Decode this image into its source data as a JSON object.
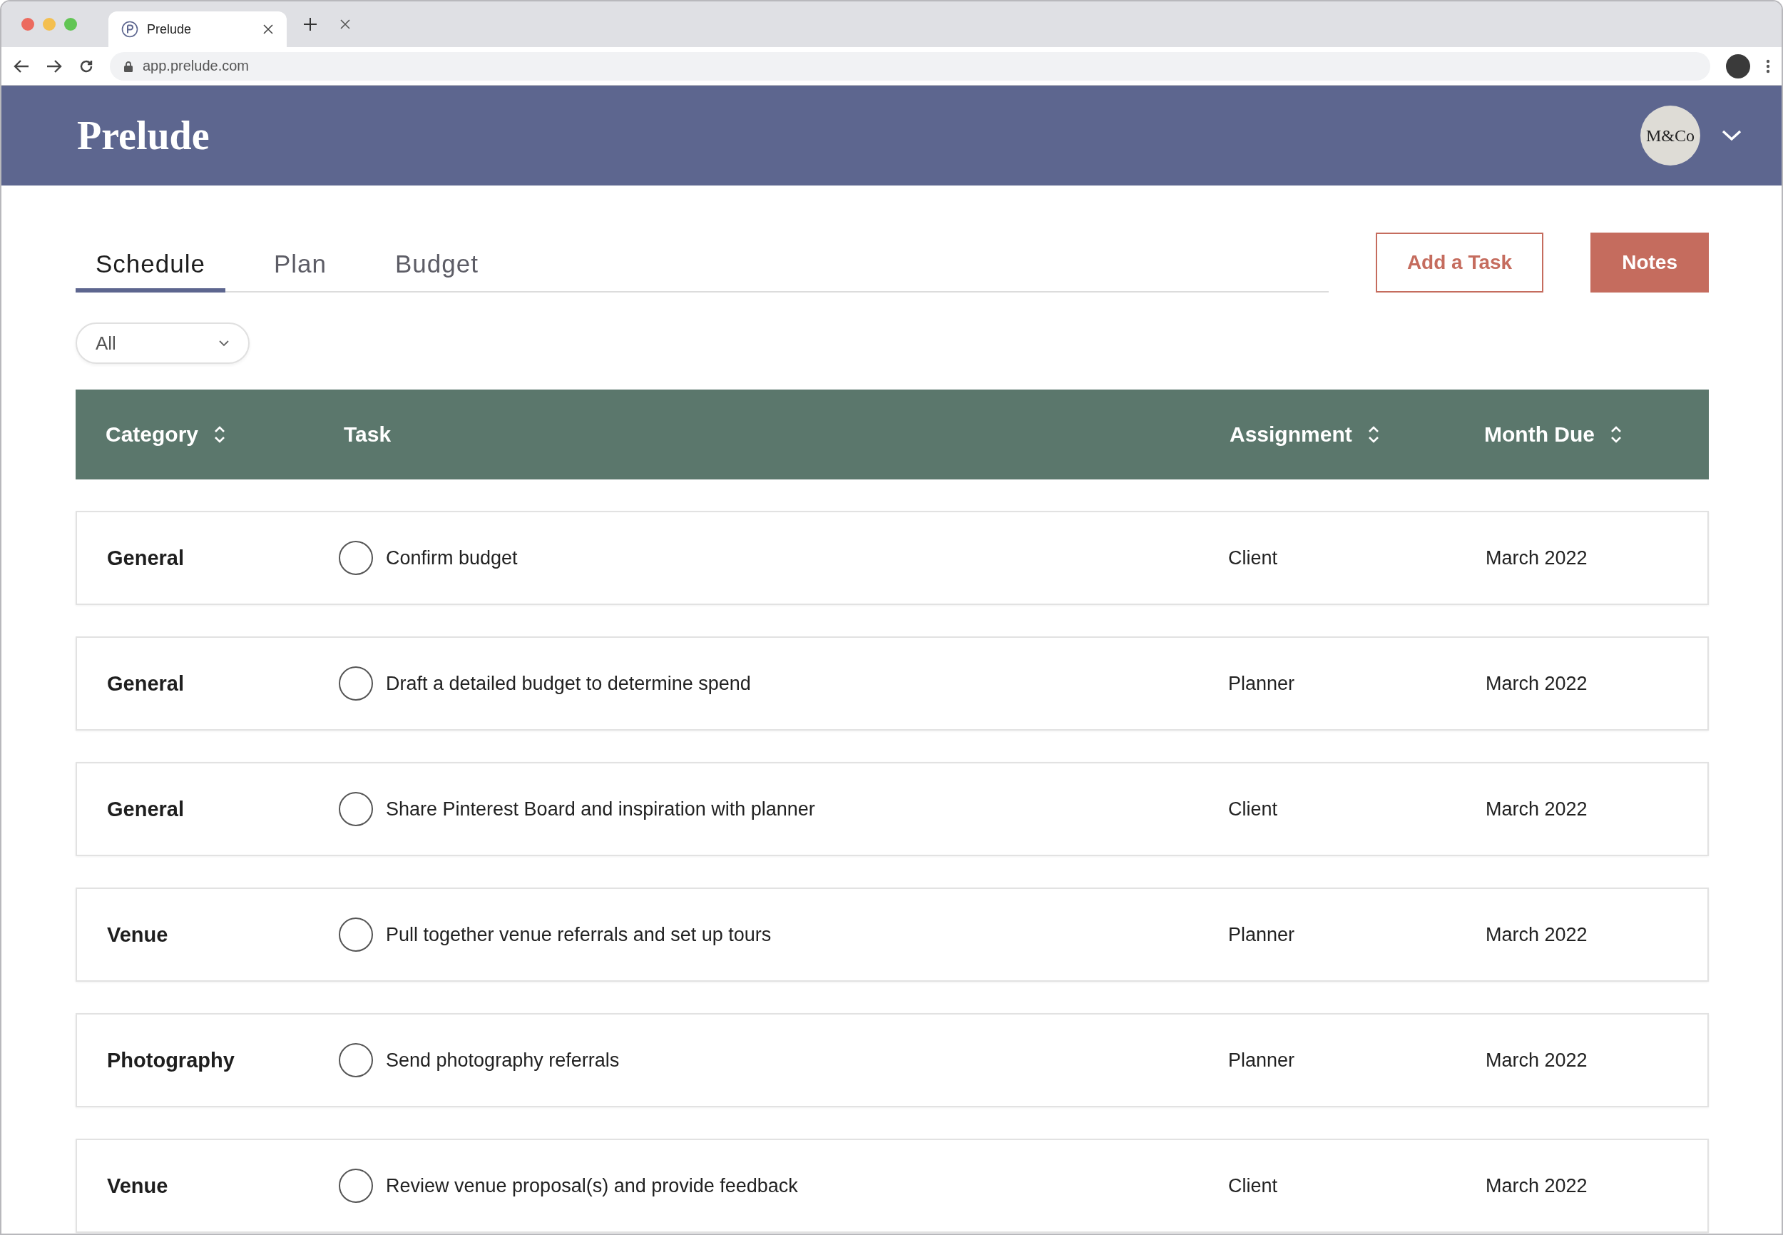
{
  "browser": {
    "tab_title": "Prelude",
    "url": "app.prelude.com"
  },
  "header": {
    "logo": "Prelude",
    "avatar_text": "M&Co"
  },
  "tabs": [
    {
      "label": "Schedule",
      "selected": true
    },
    {
      "label": "Plan",
      "selected": false
    },
    {
      "label": "Budget",
      "selected": false
    }
  ],
  "actions": [
    {
      "label": "Add a Task",
      "kind": "outline"
    },
    {
      "label": "Notes",
      "kind": "filled"
    }
  ],
  "filter": {
    "value": "All"
  },
  "table": {
    "columns": [
      {
        "label": "Category",
        "sortable": true
      },
      {
        "label": "Task",
        "sortable": false
      },
      {
        "label": "Assignment",
        "sortable": true
      },
      {
        "label": "Month Due",
        "sortable": true
      }
    ],
    "rows": [
      {
        "category": "General",
        "task": "Confirm budget",
        "checked": false,
        "assignment": "Client",
        "month": "March 2022"
      },
      {
        "category": "General",
        "task": "Draft a detailed budget to determine spend",
        "checked": false,
        "assignment": "Planner",
        "month": "March 2022"
      },
      {
        "category": "General",
        "task": "Share Pinterest Board and inspiration with planner",
        "checked": false,
        "assignment": "Client",
        "month": "March 2022"
      },
      {
        "category": "Venue",
        "task": "Pull together venue referrals and set up tours",
        "checked": false,
        "assignment": "Planner",
        "month": "March 2022"
      },
      {
        "category": "Photography",
        "task": "Send photography referrals",
        "checked": false,
        "assignment": "Planner",
        "month": "March 2022"
      },
      {
        "category": "Venue",
        "task": "Review venue proposal(s) and provide feedback",
        "checked": false,
        "assignment": "Client",
        "month": "March 2022"
      }
    ]
  }
}
